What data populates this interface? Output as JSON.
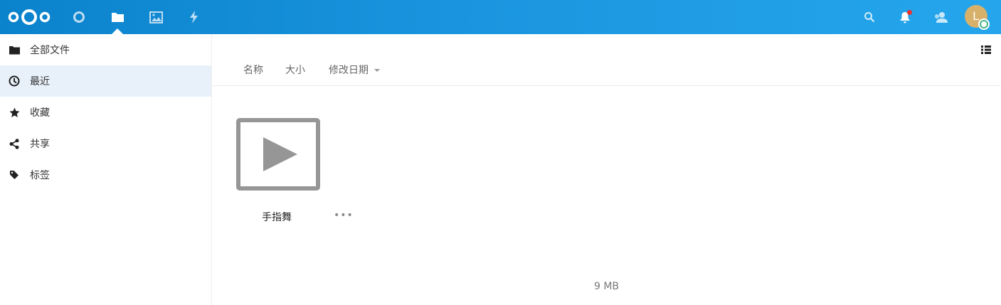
{
  "header": {
    "logo_icon": "nextcloud-logo",
    "apps": [
      {
        "name": "dashboard-icon"
      },
      {
        "name": "folder-icon",
        "active": true
      },
      {
        "name": "photos-icon"
      },
      {
        "name": "activity-icon"
      }
    ],
    "right_icons": [
      "search-icon",
      "bell-icon",
      "contacts-icon"
    ],
    "avatar_letter": "L",
    "notification_color": "#e9322d",
    "status_color": "#49b382",
    "brand_color": "#0082c9"
  },
  "sidebar": {
    "items": [
      {
        "label": "全部文件",
        "icon": "folder-icon"
      },
      {
        "label": "最近",
        "icon": "clock-icon",
        "active": true
      },
      {
        "label": "收藏",
        "icon": "star-icon"
      },
      {
        "label": "共享",
        "icon": "share-icon"
      },
      {
        "label": "标签",
        "icon": "tag-icon"
      }
    ]
  },
  "content": {
    "sort": {
      "name_label": "名称",
      "size_label": "大小",
      "modified_label": "修改日期"
    },
    "files": [
      {
        "name": "手指舞",
        "type": "video",
        "more_label": "•••"
      }
    ],
    "summary": "9 MB"
  }
}
